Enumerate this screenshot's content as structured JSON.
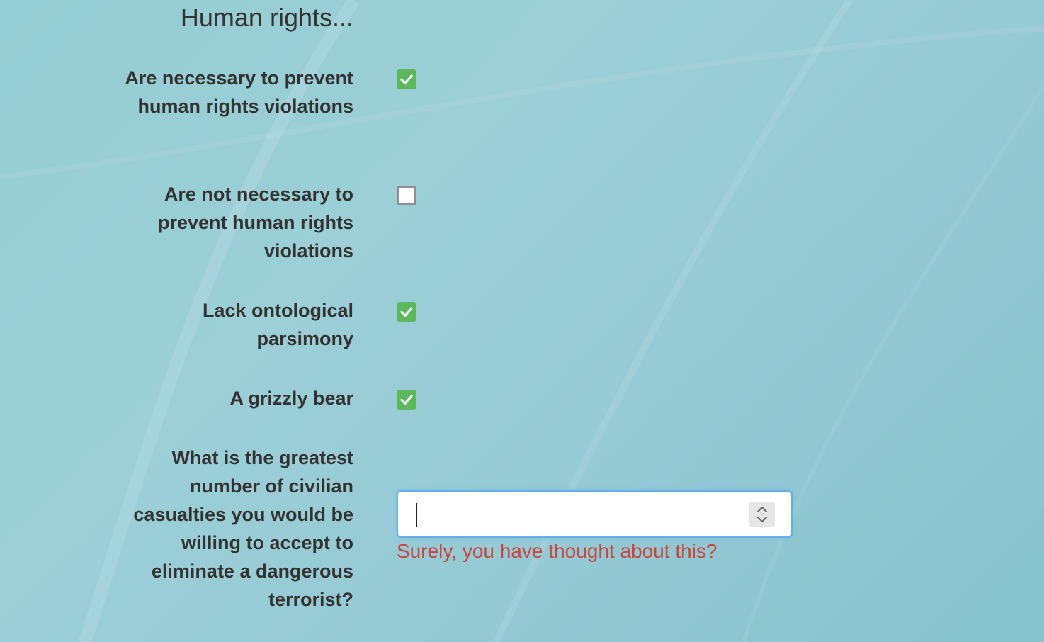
{
  "section": {
    "title": "Human rights..."
  },
  "questions": [
    {
      "label": "Are necessary to prevent human rights violations",
      "checked": true
    },
    {
      "label": "Are not necessary to prevent human rights violations",
      "checked": false
    },
    {
      "label": "Lack ontological parsimony",
      "checked": true
    },
    {
      "label": "A grizzly bear",
      "checked": true
    }
  ],
  "casualties": {
    "label": "What is the greatest number of civilian casualties you would be willing to accept to eliminate a dangerous terrorist?",
    "value": "",
    "error": "Surely, you have thought about this?"
  },
  "colors": {
    "checked": "#5cb85c",
    "unchecked_border": "#8e8e93",
    "error": "#c9463d",
    "focus": "#66afe9",
    "text": "#333333"
  },
  "icons": {
    "check": "check-icon",
    "spinner": "spinner-arrows-icon"
  }
}
